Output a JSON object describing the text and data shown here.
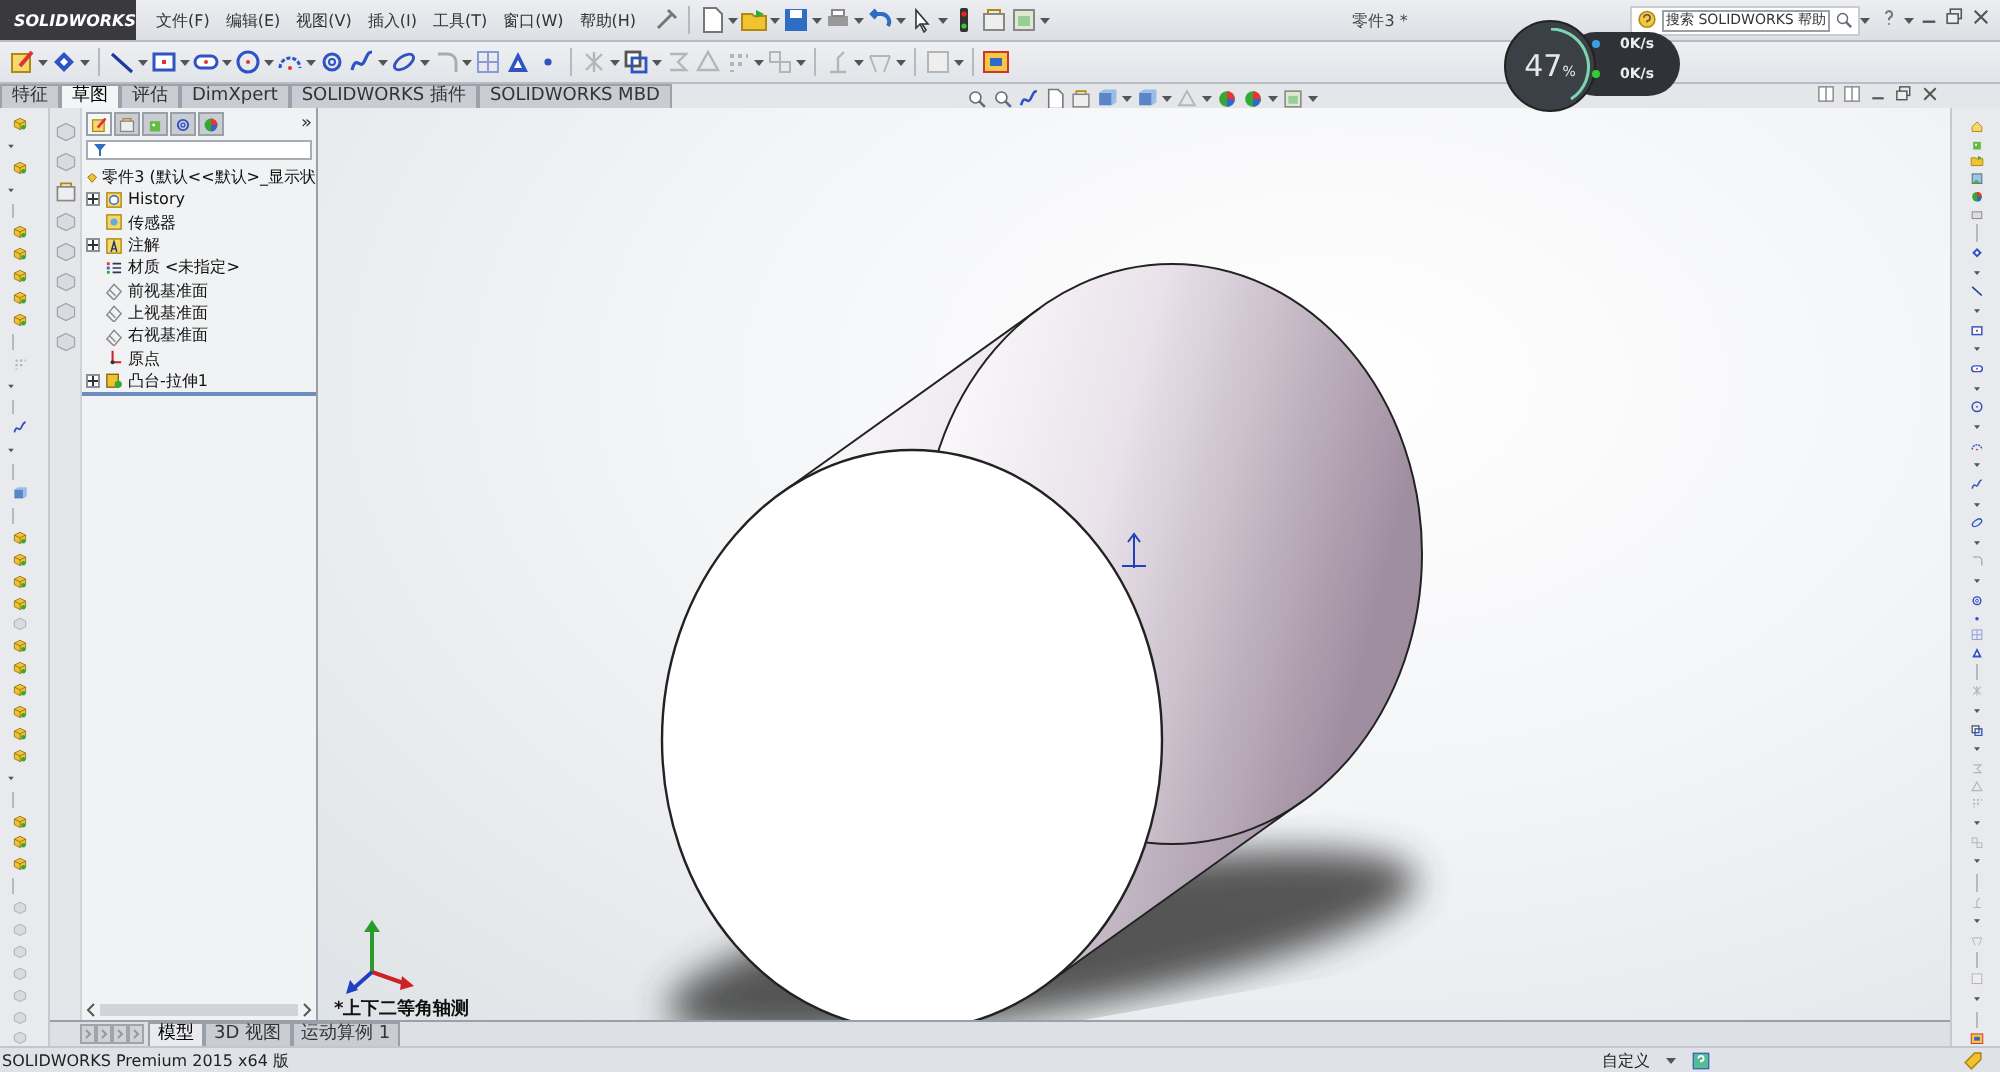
{
  "app": {
    "brand": "SOLIDWORKS"
  },
  "menu": [
    "文件(F)",
    "编辑(E)",
    "视图(V)",
    "插入(I)",
    "工具(T)",
    "窗口(W)",
    "帮助(H)"
  ],
  "document_title": "零件3 *",
  "search": {
    "placeholder": "搜索 SOLIDWORKS 帮助"
  },
  "command_tabs": [
    {
      "label": "特征",
      "selected": false
    },
    {
      "label": "草图",
      "selected": true
    },
    {
      "label": "评估",
      "selected": false
    },
    {
      "label": "DimXpert",
      "selected": false
    },
    {
      "label": "SOLIDWORKS 插件",
      "selected": false
    },
    {
      "label": "SOLIDWORKS MBD",
      "selected": false
    }
  ],
  "feature_tree": {
    "panel_tabs": [
      {
        "selected": true
      },
      {
        "selected": false
      },
      {
        "selected": false
      },
      {
        "selected": false
      },
      {
        "selected": false
      }
    ],
    "panel_expand": "»",
    "root": {
      "label": "零件3 (默认<<默认>_显示状",
      "children": [
        {
          "label": "History",
          "kind": "history",
          "has_children": true
        },
        {
          "label": "传感器",
          "kind": "sensor",
          "has_children": false
        },
        {
          "label": "注解",
          "kind": "annotation",
          "has_children": true
        },
        {
          "label": "材质 <未指定>",
          "kind": "material",
          "has_children": false
        },
        {
          "label": "前视基准面",
          "kind": "plane",
          "has_children": false
        },
        {
          "label": "上视基准面",
          "kind": "plane",
          "has_children": false
        },
        {
          "label": "右视基准面",
          "kind": "plane",
          "has_children": false
        },
        {
          "label": "原点",
          "kind": "origin",
          "has_children": false
        },
        {
          "label": "凸台-拉伸1",
          "kind": "feature",
          "has_children": true
        }
      ]
    }
  },
  "viewport": {
    "view_label": "*上下二等角轴测"
  },
  "bottom_tabs": [
    {
      "label": "模型",
      "selected": true
    },
    {
      "label": "3D 视图",
      "selected": false
    },
    {
      "label": "运动算例 1",
      "selected": false
    }
  ],
  "status_bar": {
    "product": "SOLIDWORKS Premium 2015 x64 版",
    "customize": "自定义"
  },
  "net_meter": {
    "percent": "47",
    "unit": "%",
    "upload": "0K/s",
    "download": "0K/s"
  }
}
